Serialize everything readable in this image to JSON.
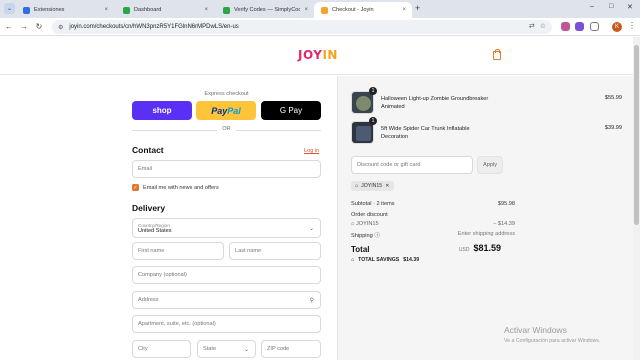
{
  "browser": {
    "tabs": [
      {
        "title": "Extensiones",
        "icon_color": "#2f6fde"
      },
      {
        "title": "Dashboard",
        "icon_color": "#29a745"
      },
      {
        "title": "Verify Codes — SimplyCodes",
        "icon_color": "#29a745"
      },
      {
        "title": "Checkout - Joyin",
        "icon_color": "#f2a42c"
      }
    ],
    "close_symbol": "×",
    "new_tab_symbol": "+",
    "url": "joyin.com/checkouts/cn/hWN3pnzR5Y1FGlnN6rMPDwLS/en-us",
    "profile_initial": "K",
    "window_controls": [
      "–",
      "□",
      "✕"
    ]
  },
  "site": {
    "logo_part1": "JOY",
    "logo_part2": "IN"
  },
  "checkout": {
    "express_label": "Express checkout",
    "shop_label": "shop",
    "paypal_pay": "Pay",
    "paypal_pal": "Pal",
    "gpay_label": "G Pay",
    "or_label": "OR",
    "contact_title": "Contact",
    "login_label": "Log in",
    "email_placeholder": "Email",
    "news_label": "Email me with news and offers",
    "delivery_title": "Delivery",
    "country_label": "Country/Region",
    "country_value": "United States",
    "first_name": "First name",
    "last_name": "Last name",
    "company": "Company (optional)",
    "address": "Address",
    "apartment": "Apartment, suite, etc. (optional)",
    "city": "City",
    "state": "State",
    "zip": "ZIP code"
  },
  "summary": {
    "items": [
      {
        "name": "Halloween Light-up Zombie Groundbreaker Animated",
        "price": "$55.99",
        "qty": "1"
      },
      {
        "name": "5ft Wide Spider Car Trunk Inflatable Decoration",
        "price": "$39.99",
        "qty": "1"
      }
    ],
    "discount_placeholder": "Discount code or gift card",
    "apply_label": "Apply",
    "applied_code": "JOYIN15",
    "subtotal_label": "Subtotal · 2 items",
    "subtotal_value": "$95.98",
    "order_discount_label": "Order discount",
    "discount_code": "JOYIN15",
    "discount_value": "– $14.39",
    "shipping_label": "Shipping",
    "shipping_value": "Enter shipping address",
    "total_label": "Total",
    "currency": "USD",
    "total_value": "$81.59",
    "savings_label": "TOTAL SAVINGS",
    "savings_value": "$14.39"
  },
  "watermark": {
    "line1": "Activar Windows",
    "line2": "Ve a Configuración para activar Windows."
  }
}
